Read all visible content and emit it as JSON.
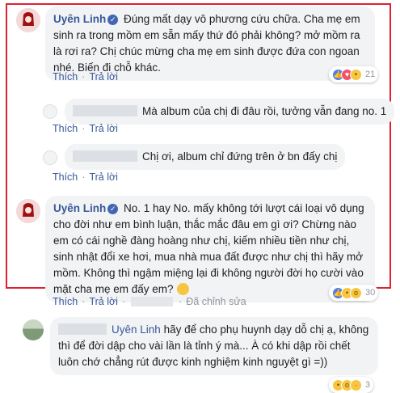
{
  "colors": {
    "highlight_border": "#e02030",
    "link": "#385898",
    "bubble_bg": "#f2f3f5"
  },
  "comments": [
    {
      "author": "Uyên Linh",
      "text": "Đúng mất dạy vô phương cứu chữa. Cha mẹ em sinh ra trong mồm em sẵn mấy thứ đó phải không? mở mồm ra là rơi ra? Chị chúc mừng cha mẹ em sinh được đứa con ngoan nhé. Biến đi chỗ khác.",
      "actions": {
        "like": "Thích",
        "reply": "Trả lời"
      },
      "reactions": {
        "icons": [
          "like-icon",
          "heart-icon",
          "haha-icon"
        ],
        "count": "21"
      }
    },
    {
      "text": "Mà album của chị đi đâu rồi, tưởng vẫn đang no. 1",
      "actions": {
        "like": "Thích",
        "reply": "Trả lời"
      }
    },
    {
      "text": "Chị ơi, album chỉ đứng trên ở bn đấy chị",
      "actions": {
        "like": "Thích",
        "reply": "Trả lời"
      }
    },
    {
      "author": "Uyên Linh",
      "text": "No. 1 hay No. mấy không tới lượt cái loại vô dụng cho đời như em bình luận, thắc mắc đâu em gì ơi? Chừng nào em có cái nghề đàng hoàng như chị, kiếm nhiều tiền như chị, sinh nhật đổi xe hơi, mua nhà mua đất được như chị thì hãy mở mồm. Không thì ngậm miệng lại đi không người đời họ cười vào mặt cha mẹ em đấy em?",
      "emoji": "smile-icon",
      "actions": {
        "like": "Thích",
        "reply": "Trả lời",
        "edited": "Đã chỉnh sửa"
      },
      "reactions": {
        "icons": [
          "like-icon",
          "haha-icon",
          "wow-icon"
        ],
        "count": "30"
      }
    },
    {
      "mention": "Uyên Linh",
      "text": "hãy để cho phụ huynh dạy dỗ chị ạ, không thì để đời dập cho vài lần là tỉnh ý mà... À có khi dập rồi chết luôn chớ chẳng rút được kinh nghiệm kinh nguyệt gì =))",
      "actions": {
        "like": "Thích",
        "reply": "Trả lời"
      },
      "reactions": {
        "icons": [
          "haha-icon",
          "wow-icon",
          "sad-icon"
        ],
        "count": "3"
      }
    }
  ]
}
